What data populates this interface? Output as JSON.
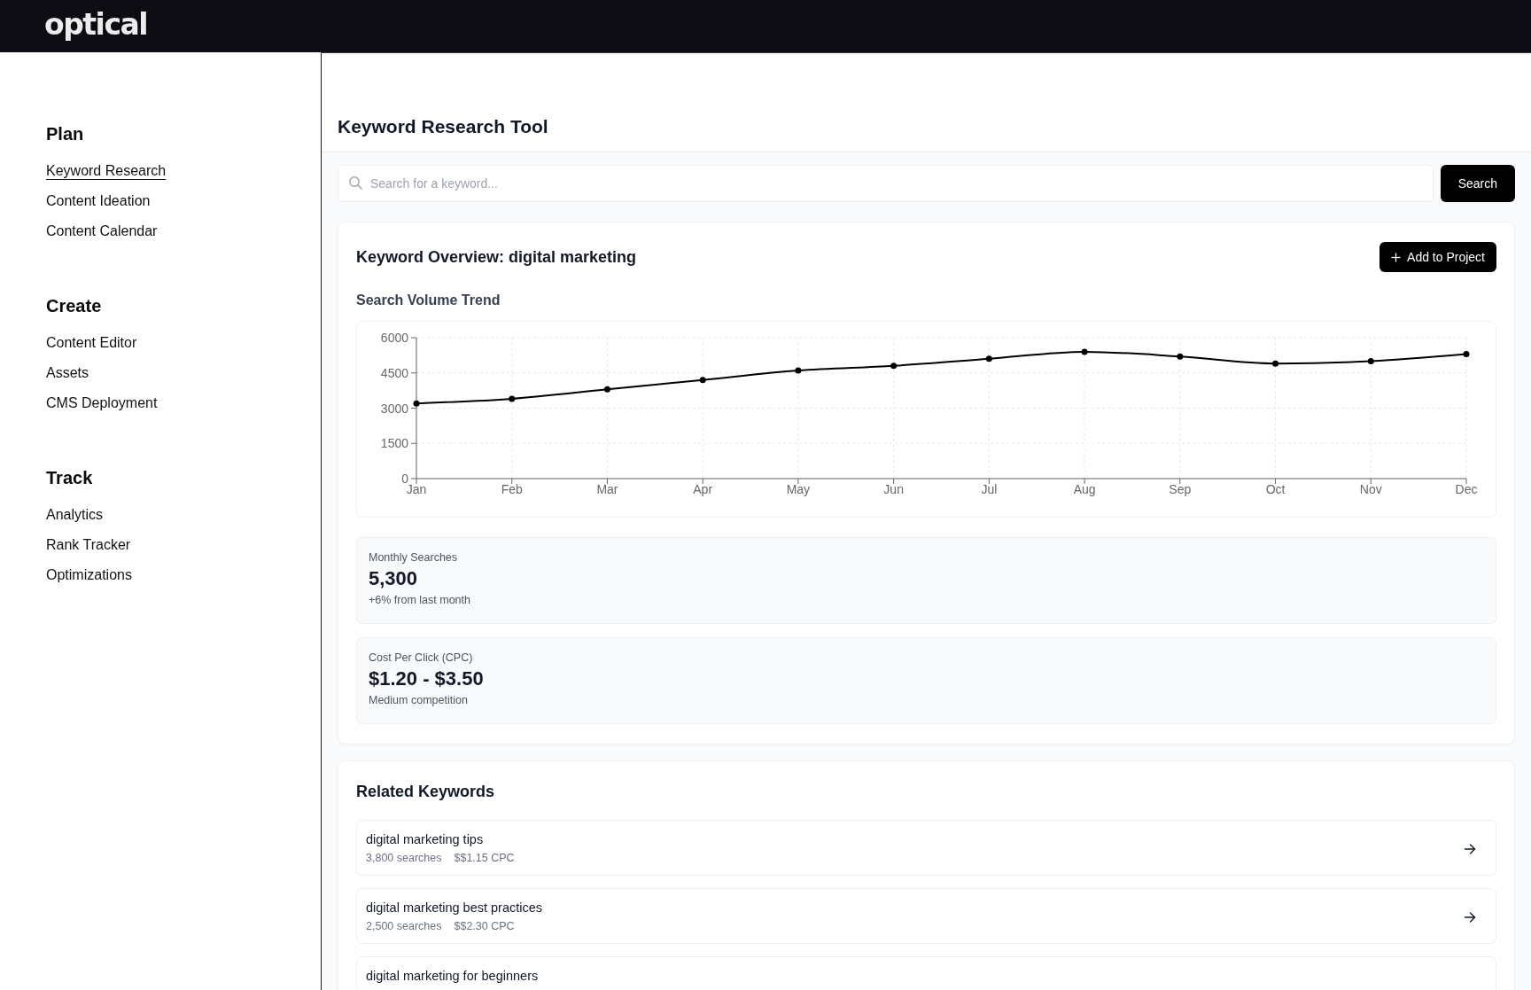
{
  "top_bar": {
    "logo": "optical"
  },
  "sidebar": {
    "sections": [
      {
        "heading": "Plan",
        "items": [
          {
            "label": "Keyword Research",
            "selected": true
          },
          {
            "label": "Content Ideation",
            "selected": false
          },
          {
            "label": "Content Calendar",
            "selected": false
          }
        ]
      },
      {
        "heading": "Create",
        "items": [
          {
            "label": "Content Editor",
            "selected": false
          },
          {
            "label": "Assets",
            "selected": false
          },
          {
            "label": "CMS Deployment",
            "selected": false
          }
        ]
      },
      {
        "heading": "Track",
        "items": [
          {
            "label": "Analytics",
            "selected": false
          },
          {
            "label": "Rank Tracker",
            "selected": false
          },
          {
            "label": "Optimizations",
            "selected": false
          }
        ]
      }
    ]
  },
  "header": {
    "title": "Keyword Research Tool"
  },
  "search": {
    "placeholder": "Search for a keyword...",
    "button": "Search"
  },
  "overview": {
    "title": "Keyword Overview: digital marketing",
    "add_button": "Add to Project",
    "chart_title": "Search Volume Trend",
    "chart_data": {
      "type": "line",
      "categories": [
        "Jan",
        "Feb",
        "Mar",
        "Apr",
        "May",
        "Jun",
        "Jul",
        "Aug",
        "Sep",
        "Oct",
        "Nov",
        "Dec"
      ],
      "series": [
        {
          "color": "#000000",
          "marker": "circle",
          "values": [
            3200,
            3400,
            3800,
            4200,
            4600,
            4800,
            5100,
            5400,
            5200,
            4900,
            5000,
            5300
          ]
        }
      ],
      "ylim": [
        0,
        6000
      ],
      "yticks": [
        0,
        1500,
        3000,
        4500,
        6000
      ],
      "grid": true
    },
    "stats": [
      {
        "label": "Monthly Searches",
        "value": "5,300",
        "note": "+6% from last month"
      },
      {
        "label": "Cost Per Click (CPC)",
        "value": "$1.20 - $3.50",
        "note": "Medium competition"
      }
    ]
  },
  "related": {
    "title": "Related Keywords",
    "keywords": [
      {
        "keyword": "digital marketing tips",
        "searches": "3,800 searches",
        "cpc": "$$1.15 CPC"
      },
      {
        "keyword": "digital marketing best practices",
        "searches": "2,500 searches",
        "cpc": "$$2.30 CPC"
      },
      {
        "keyword": "digital marketing for beginners"
      }
    ]
  }
}
